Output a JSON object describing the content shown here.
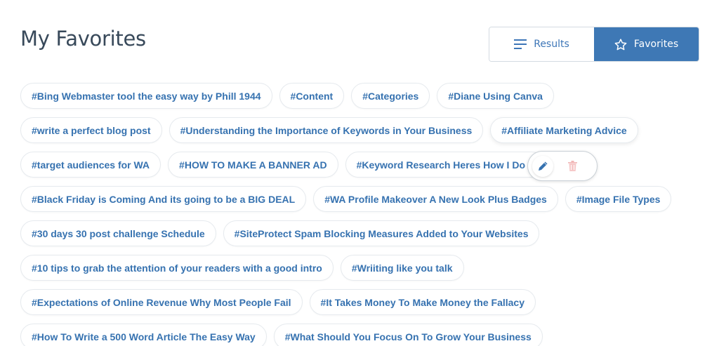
{
  "header": {
    "title": "My Favorites"
  },
  "view_toggle": {
    "results_label": "Results",
    "favorites_label": "Favorites",
    "active": "Favorites",
    "active_color": "#3e78b5"
  },
  "icons": {
    "results": "list-lines-icon",
    "favorites": "star-outline-icon",
    "edit": "pencil-icon",
    "delete": "trash-icon"
  },
  "tag_rows": [
    [
      "#Bing Webmaster tool the easy way by Phill 1944",
      "#Content",
      "#Categories",
      "#Diane Using Canva"
    ],
    [
      "#write a perfect blog post",
      "#Understanding the Importance of Keywords in Your Business",
      "#Affiliate Marketing Advice"
    ],
    [
      "#target audiences for WA",
      "#HOW TO MAKE A BANNER AD",
      "#Keyword Research Heres How I Do It"
    ],
    [
      "#Black Friday is Coming And its going to be a BIG DEAL",
      "#WA Profile Makeover A New Look Plus Badges",
      "#Image File Types"
    ],
    [
      "#30 days 30 post challenge Schedule",
      "#SiteProtect Spam Blocking Measures Added to Your Websites"
    ],
    [
      "#10 tips to grab the attention of your readers with a good intro",
      "#Wriiting like you talk"
    ],
    [
      "#Expectations of Online Revenue Why Most People Fail",
      "#It Takes Money To Make Money the Fallacy"
    ],
    [
      "#How To Write a 500 Word Article The Easy Way",
      "#What Should You Focus On To Grow Your Business"
    ]
  ]
}
